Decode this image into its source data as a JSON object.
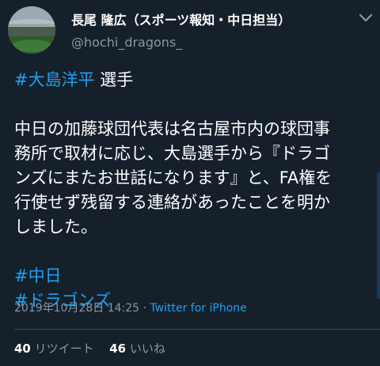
{
  "author": {
    "display_name": "長尾 隆広（スポーツ報知・中日担当）",
    "handle": "@hochi_dragons_"
  },
  "tweet": {
    "lines": [
      {
        "hashtag": "#大島洋平",
        "text": " 選手"
      },
      {
        "text": "中日の加藤球団代表は名古屋市内の球団事"
      },
      {
        "text": "務所で取材に応じ、大島選手から『ドラゴ"
      },
      {
        "text": "ンズにまたお世話になります』と、FA権を"
      },
      {
        "text": "行使せず残留する連絡があったことを明か"
      },
      {
        "text": "しました。"
      }
    ],
    "hashtags": [
      "#中日",
      "#ドラゴンズ"
    ]
  },
  "meta": {
    "timestamp": "2019年10月28日 14:25",
    "separator": " · ",
    "source": "Twitter for iPhone"
  },
  "stats": {
    "retweets_count": "40",
    "retweets_label": " リツイート",
    "likes_count": "46",
    "likes_label": " いいね"
  },
  "colors": {
    "background": "#15202b",
    "link": "#1da1f2",
    "secondary_text": "#8899a6"
  }
}
